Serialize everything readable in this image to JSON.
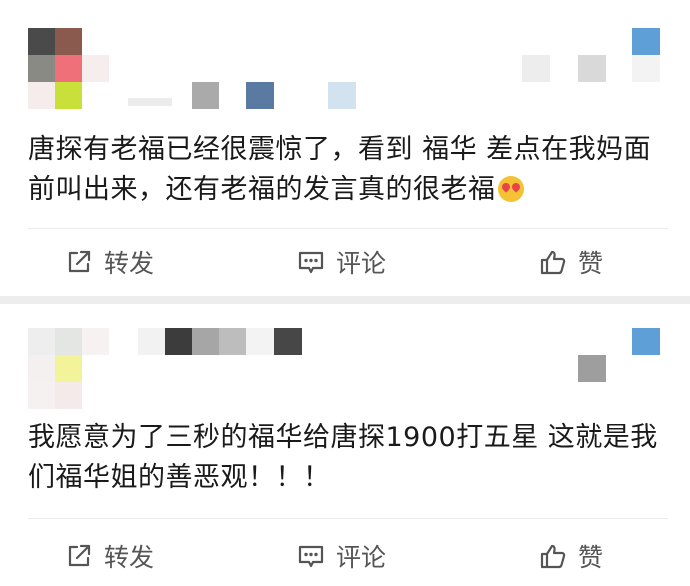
{
  "posts": [
    {
      "text": "唐探有老福已经很震惊了，看到 福华 差点在我妈面前叫出来，还有老福的发言真的很老福",
      "emoji_icon": "heart-eyes-emoji-icon",
      "actions": {
        "repost": "转发",
        "comment": "评论",
        "like": "赞"
      }
    },
    {
      "text": "我愿意为了三秒的福华给唐探1900打五星 这就是我们福华姐的善恶观！！！",
      "actions": {
        "repost": "转发",
        "comment": "评论",
        "like": "赞"
      }
    }
  ],
  "colors": {
    "text": "#1a1a1a",
    "action_text": "#555555",
    "background": "#ededed",
    "card": "#ffffff"
  }
}
